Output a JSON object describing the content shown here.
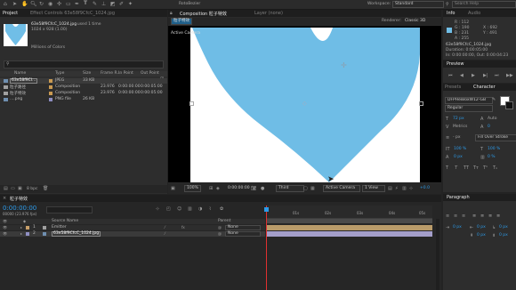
{
  "toolbar": {
    "script_label": "RotoBezier",
    "workspace_label": "Workspace:",
    "workspace_value": "Standard",
    "search_placeholder": "Search Help"
  },
  "project": {
    "tab_label": "Project",
    "effect_tab_label": "Effect Controls 63e58f9CfcC_1024.jpg",
    "file_name": "63e58f9CfcC_1024.jpg",
    "used_text": ", used 1 time",
    "dimensions": "1024 x 928 (1.00)",
    "color_info": "Millions of Colors",
    "search_placeholder": "",
    "columns": [
      "Name",
      "Type",
      "Size",
      "Frame R...",
      "In Point",
      "Out Point"
    ],
    "items": [
      {
        "name": "63e58f9Cl...",
        "type": "JPEG",
        "size": "33 KB",
        "rate": "",
        "in": "",
        "out": "",
        "color": "#c99a52"
      },
      {
        "name": "粒子路径",
        "type": "Composition",
        "size": "",
        "rate": "23.976",
        "in": "0:00:00:00",
        "out": "0:00:05:00",
        "color": "#c99a52"
      },
      {
        "name": "粒子特效",
        "type": "Composition",
        "size": "",
        "rate": "23.976",
        "in": "0:00:00:00",
        "out": "0:00:05:00",
        "color": "#c99a52"
      },
      {
        "name": "....png",
        "type": "PNG file",
        "size": "26 KB",
        "rate": "",
        "in": "",
        "out": "",
        "color": "#8d8dc0"
      }
    ],
    "bpc_label": "8 bpc"
  },
  "composition": {
    "tab_label": "Composition 粒子特效",
    "layer_tab_label": "Layer (none)",
    "comp_tab": "粒子特效",
    "renderer_label": "Renderer:",
    "renderer_value": "Classic 3D",
    "active_camera_overlay": "Active Camera",
    "zoom": "100%",
    "timecode": "0:00:00:00",
    "resolution": "Third",
    "camera": "Active Camera",
    "views": "1 View",
    "exposure": "+0.0"
  },
  "info": {
    "tab_label": "Info",
    "audio_tab": "Audio",
    "r": "R : 112",
    "g": "G : 190",
    "b": "B : 231",
    "a": "A : 255",
    "x": "X : 692",
    "y": "Y : 491",
    "comp_name": "63e58f9CfcC_1024.jpg",
    "duration": "Duration: 0:00:05:00",
    "in_out": "In: 0:00:00:00, Out: 0:00:04:23",
    "swatch_color": "#70bee7"
  },
  "preview": {
    "tab_label": "Preview"
  },
  "character": {
    "presets_tab": "Presets",
    "tab_label": "Character",
    "font": "DFPHeiBoxW12-GB",
    "style": "Regular",
    "size": "72 px",
    "leading": "Auto",
    "kerning": "Metrics",
    "tracking": "0",
    "stroke": "- px",
    "stroke_type": "Fill Over Stroke",
    "v_scale": "100 %",
    "h_scale": "100 %",
    "baseline": "0 px",
    "tsume": "0 %"
  },
  "paragraph": {
    "tab_label": "Paragraph",
    "indent1": "0 px",
    "indent2": "0 px",
    "indent3": "0 px",
    "space1": "0 px",
    "space2": "0 px"
  },
  "timeline": {
    "tab_label": "粒子特效",
    "timecode": "0:00:00:00",
    "frame_info": "00000 (23.976 fps)",
    "source_header": "Source Name",
    "parent_header": "Parent",
    "ruler_ticks": [
      "01s",
      "02s",
      "03s",
      "04s",
      "05s"
    ],
    "layers": [
      {
        "num": "1",
        "name": "Emitter",
        "parent": "None",
        "color": "#c8a06a",
        "bar": "#b99b6a"
      },
      {
        "num": "2",
        "name": "63e58f9CfcC_1024.jpg",
        "parent": "None",
        "color": "#8f8fc3",
        "bar": "#a49ec9"
      }
    ],
    "toggle_label": "Toggle Switches / Modes"
  }
}
